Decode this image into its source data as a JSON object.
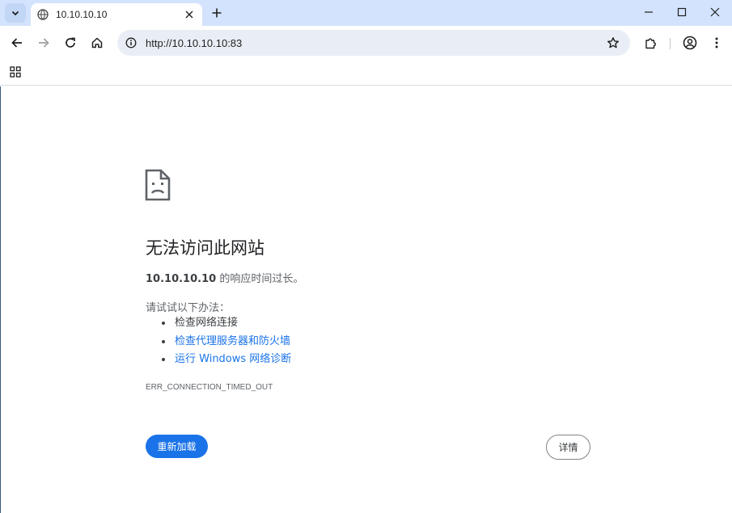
{
  "tab": {
    "title": "10.10.10.10"
  },
  "omnibox": {
    "url": "http://10.10.10.10:83"
  },
  "error": {
    "title": "无法访问此网站",
    "host": "10.10.10.10",
    "desc_suffix": " 的响应时间过长。",
    "try_label": "请试试以下办法：",
    "suggestions": [
      {
        "label": "检查网络连接",
        "link": false
      },
      {
        "label": "检查代理服务器和防火墙",
        "link": true
      },
      {
        "label": "运行 Windows 网络诊断",
        "link": true
      }
    ],
    "code": "ERR_CONNECTION_TIMED_OUT",
    "reload_label": "重新加载",
    "details_label": "详情"
  },
  "icons": {
    "tab_search": "chevron-down-icon",
    "favicon": "globe-icon",
    "tab_close": "close-icon",
    "new_tab": "plus-icon",
    "minimize": "minimize-icon",
    "maximize": "maximize-icon",
    "close": "close-icon",
    "back": "back-arrow-icon",
    "forward": "forward-arrow-icon",
    "reload": "reload-icon",
    "home": "home-icon",
    "site_info": "info-icon",
    "bookmark": "star-icon",
    "extensions": "puzzle-icon",
    "profile": "profile-icon",
    "menu": "kebab-menu-icon",
    "apps": "apps-grid-icon",
    "error": "sad-page-icon"
  },
  "colors": {
    "tabstrip": "#d3e3fd",
    "omnibox": "#e9eef6",
    "accent": "#1a73e8",
    "text": "#202124",
    "secondary_text": "#5f6368"
  }
}
